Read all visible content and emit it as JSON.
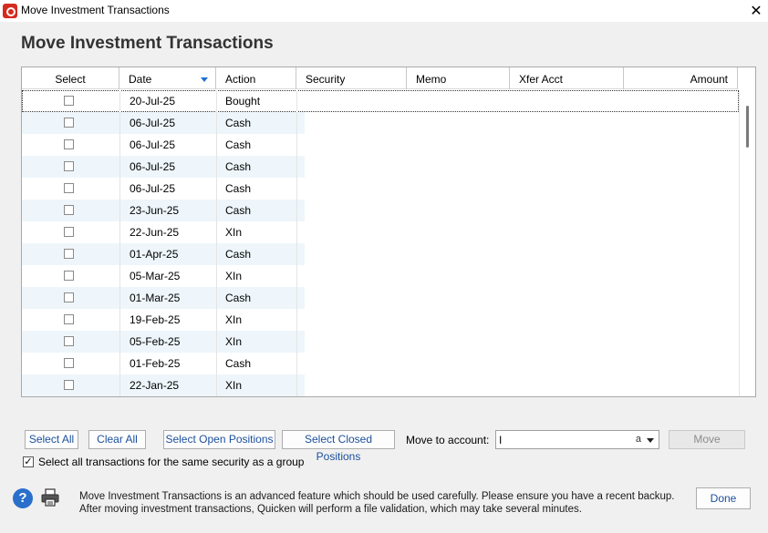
{
  "window": {
    "title": "Move Investment Transactions",
    "close_glyph": "✕"
  },
  "heading": "Move Investment Transactions",
  "columns": {
    "select": "Select",
    "date": "Date",
    "action": "Action",
    "security": "Security",
    "memo": "Memo",
    "xfer": "Xfer Acct",
    "amount": "Amount"
  },
  "rows": [
    {
      "date": "20-Jul-25",
      "action": "Bought"
    },
    {
      "date": "06-Jul-25",
      "action": "Cash"
    },
    {
      "date": "06-Jul-25",
      "action": "Cash"
    },
    {
      "date": "06-Jul-25",
      "action": "Cash"
    },
    {
      "date": "06-Jul-25",
      "action": "Cash"
    },
    {
      "date": "23-Jun-25",
      "action": "Cash"
    },
    {
      "date": "22-Jun-25",
      "action": "XIn"
    },
    {
      "date": "01-Apr-25",
      "action": "Cash"
    },
    {
      "date": "05-Mar-25",
      "action": "XIn"
    },
    {
      "date": "01-Mar-25",
      "action": "Cash"
    },
    {
      "date": "19-Feb-25",
      "action": "XIn"
    },
    {
      "date": "05-Feb-25",
      "action": "XIn"
    },
    {
      "date": "01-Feb-25",
      "action": "Cash"
    },
    {
      "date": "22-Jan-25",
      "action": "XIn"
    }
  ],
  "buttons": {
    "select_all": "Select All",
    "clear_all": "Clear All",
    "select_open": "Select Open Positions",
    "select_closed": "Select Closed Positions",
    "move": "Move",
    "done": "Done"
  },
  "move_to": {
    "label": "Move to account:",
    "value": "I",
    "clipped_text": "a"
  },
  "group_checkbox": {
    "label": "Select all transactions for the same security as a group",
    "checked": true
  },
  "note": "Move Investment Transactions is an advanced feature which should be used carefully. Please ensure you have a recent backup. After moving investment transactions, Quicken will perform a file validation, which may take several minutes.",
  "help_glyph": "?",
  "colors": {
    "accent": "#1e6fcf",
    "row_alt": "#eef6fb",
    "brand": "#d52b1e"
  }
}
